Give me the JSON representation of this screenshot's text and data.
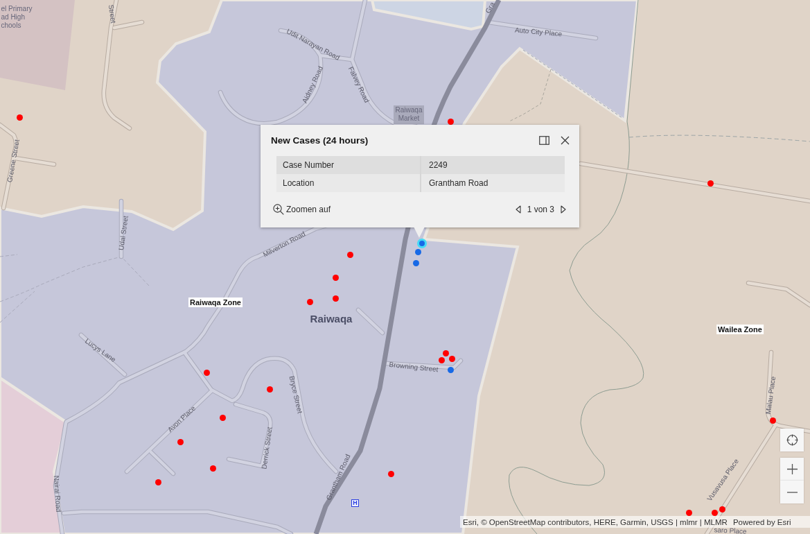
{
  "map": {
    "labels": [
      {
        "text": "el Primary\nad High\nchools",
        "kind": "place"
      },
      {
        "text": "Street",
        "kind": "street"
      },
      {
        "text": "Udit Narayan Road",
        "kind": "street"
      },
      {
        "text": "Aidney Road",
        "kind": "street"
      },
      {
        "text": "Falvey Road",
        "kind": "street"
      },
      {
        "text": "Raiwaqa\nMarket",
        "kind": "place"
      },
      {
        "text": "Gra",
        "kind": "street"
      },
      {
        "text": "Auto City Place",
        "kind": "street"
      },
      {
        "text": "Greene Street",
        "kind": "street"
      },
      {
        "text": "Udal Street",
        "kind": "street"
      },
      {
        "text": "Milverton Road",
        "kind": "street"
      },
      {
        "text": "Raiwaqa Zone",
        "kind": "zone"
      },
      {
        "text": "Raiwaqa",
        "kind": "area"
      },
      {
        "text": "Lucys Lane",
        "kind": "street"
      },
      {
        "text": "Browning Street",
        "kind": "street"
      },
      {
        "text": "Bryce Street",
        "kind": "street"
      },
      {
        "text": "Avon Place",
        "kind": "street"
      },
      {
        "text": "Derrick Street",
        "kind": "street"
      },
      {
        "text": "Grantham Road",
        "kind": "street"
      },
      {
        "text": "Nairai Road",
        "kind": "street"
      },
      {
        "text": "Wailea Zone",
        "kind": "zone"
      },
      {
        "text": "Malau Place",
        "kind": "street"
      },
      {
        "text": "Vusavusa Place",
        "kind": "street"
      },
      {
        "text": "saro Place",
        "kind": "street"
      }
    ],
    "markers": [
      {
        "color": "#ff0000",
        "selected": false
      },
      {
        "color": "#ff0000",
        "selected": false
      },
      {
        "color": "#ff0000",
        "selected": false
      },
      {
        "color": "#ff0000",
        "selected": false
      },
      {
        "color": "#ff0000",
        "selected": false
      },
      {
        "color": "#ff0000",
        "selected": false
      },
      {
        "color": "#ff0000",
        "selected": false
      },
      {
        "color": "#ff0000",
        "selected": false
      },
      {
        "color": "#ff0000",
        "selected": false
      },
      {
        "color": "#ff0000",
        "selected": false
      },
      {
        "color": "#1769e6",
        "selected": false
      },
      {
        "color": "#ff0000",
        "selected": false
      },
      {
        "color": "#ff0000",
        "selected": false
      },
      {
        "color": "#ff0000",
        "selected": false
      },
      {
        "color": "#ff0000",
        "selected": false
      },
      {
        "color": "#ff0000",
        "selected": false
      },
      {
        "color": "#ff0000",
        "selected": false
      },
      {
        "color": "#ff0000",
        "selected": false
      },
      {
        "color": "#ff0000",
        "selected": false
      },
      {
        "color": "#ff0000",
        "selected": false
      },
      {
        "color": "#ff0000",
        "selected": false
      },
      {
        "color": "#ff0000",
        "selected": false
      },
      {
        "color": "#1769e6",
        "selected": false
      },
      {
        "color": "#1769e6",
        "selected": false
      },
      {
        "color": "#1769e6",
        "selected": true
      }
    ],
    "hospital_sign": "H"
  },
  "popup": {
    "title": "New Cases (24 hours)",
    "fields": [
      {
        "label": "Case Number",
        "value": "2249"
      },
      {
        "label": "Location",
        "value": "Grantham Road"
      }
    ],
    "zoom_action": "Zoomen auf",
    "pager": "1 von 3"
  },
  "attribution": {
    "sources": "Esri, © OpenStreetMap contributors, HERE, Garmin, USGS | mlmr | MLMR",
    "powered_by": "Powered by Esri"
  }
}
